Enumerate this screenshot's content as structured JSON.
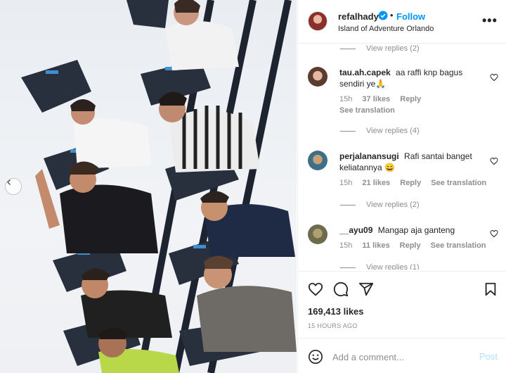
{
  "post": {
    "username": "refalhady",
    "follow_label": "Follow",
    "separator": "•",
    "location": "Island of Adventure Orlando",
    "more_label": "•••"
  },
  "comments": {
    "replies_top": "View replies (2)",
    "items": [
      {
        "username": "tau.ah.capek",
        "text": "aa raffi knp bagus sendiri ye🙏",
        "time": "15h",
        "likes": "37 likes",
        "reply": "Reply",
        "translation": "See translation",
        "view_replies": "View replies (4)"
      },
      {
        "username": "perjalanansugi",
        "text": "Rafi santai banget keliatannya 😄",
        "time": "15h",
        "likes": "21 likes",
        "reply": "Reply",
        "translation": "See translation",
        "view_replies": "View replies (2)"
      },
      {
        "username": "__ayu09",
        "text": "Mangap aja ganteng",
        "time": "15h",
        "likes": "11 likes",
        "reply": "Reply",
        "translation": "See translation",
        "view_replies": "View replies (1)"
      }
    ]
  },
  "stats": {
    "likes": "169,413 likes",
    "posted": "15 HOURS AGO"
  },
  "composer": {
    "placeholder": "Add a comment...",
    "post_label": "Post"
  },
  "icons": {
    "verified": "verified-badge-icon",
    "like": "heart-icon",
    "comment": "comment-icon",
    "share": "paper-plane-icon",
    "save": "bookmark-icon",
    "emoji": "emoji-icon",
    "prev": "chevron-left-icon"
  },
  "colors": {
    "accent": "#0095f6",
    "muted": "#8e8e8e",
    "text": "#262626"
  }
}
